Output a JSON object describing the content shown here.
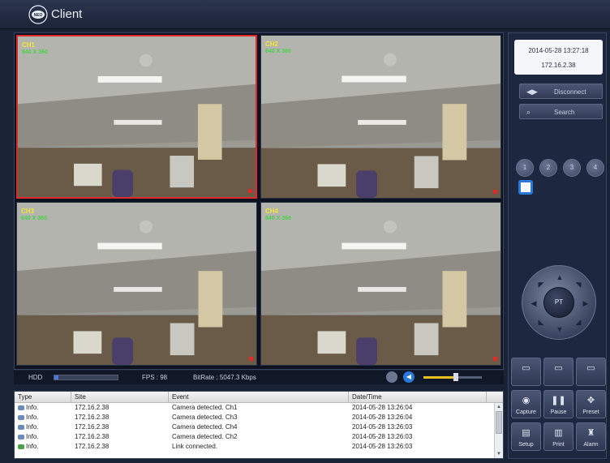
{
  "app": {
    "title": "Client",
    "logo_text": "NEO"
  },
  "cameras": [
    {
      "label": "CH1",
      "resolution": "640 X 360"
    },
    {
      "label": "CH2",
      "resolution": "640 X 360"
    },
    {
      "label": "CH3",
      "resolution": "640 X 360"
    },
    {
      "label": "CH4",
      "resolution": "640 X 360"
    }
  ],
  "status": {
    "hdd_label": "HDD",
    "hdd_usage_fraction": 0.06,
    "fps": "FPS : 98",
    "bitrate": "BitRate : 5047.3 Kbps",
    "volume_fraction": 0.55
  },
  "log": {
    "columns": [
      "Type",
      "Site",
      "Event",
      "Date/Time"
    ],
    "rows": [
      {
        "type": "Info.",
        "site": "172.16.2.38",
        "event": "Camera detected. Ch1",
        "datetime": "2014-05-28 13:26:04"
      },
      {
        "type": "Info.",
        "site": "172.16.2.38",
        "event": "Camera detected. Ch3",
        "datetime": "2014-05-28 13:26:04"
      },
      {
        "type": "Info.",
        "site": "172.16.2.38",
        "event": "Camera detected. Ch4",
        "datetime": "2014-05-28 13:26:03"
      },
      {
        "type": "Info.",
        "site": "172.16.2.38",
        "event": "Camera detected. Ch2",
        "datetime": "2014-05-28 13:26:03"
      },
      {
        "type": "Info.",
        "site": "172.16.2.38",
        "event": "Link connected.",
        "datetime": "2014-05-28 13:26:03"
      }
    ]
  },
  "panel": {
    "datetime": "2014-05-28 13:27:18",
    "ip": "172.16.2.38",
    "disconnect_label": "Disconnect",
    "search_label": "Search",
    "channel_buttons": [
      "1",
      "2",
      "3",
      "4"
    ],
    "ptz_label": "PT"
  },
  "tools": {
    "row1": [
      "",
      "",
      ""
    ],
    "capture": "Capture",
    "pause": "Pause",
    "preset": "Preset",
    "setup": "Setup",
    "print": "Print",
    "alarm": "Alarm"
  },
  "colors": {
    "active_border": "#e02a2a",
    "accent": "#2a78d8",
    "cam_label": "#f4e43a",
    "cam_res": "#48d24a"
  }
}
